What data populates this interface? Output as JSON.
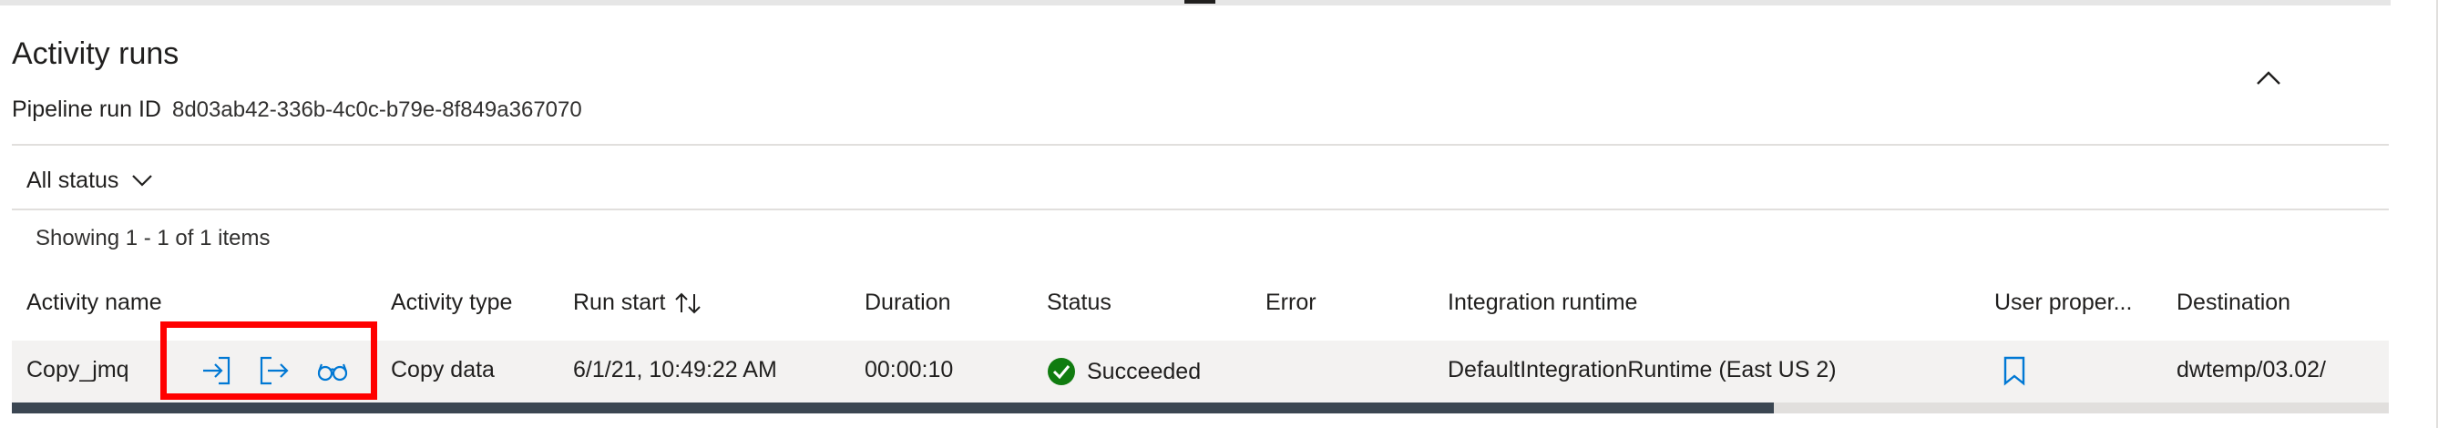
{
  "panel": {
    "title": "Activity runs",
    "run_id_label": "Pipeline run ID",
    "run_id_value": "8d03ab42-336b-4c0c-b79e-8f849a367070"
  },
  "filter": {
    "status_label": "All status"
  },
  "summary": {
    "showing": "Showing 1 - 1 of 1 items"
  },
  "table": {
    "columns": {
      "activity_name": "Activity name",
      "activity_type": "Activity type",
      "run_start": "Run start",
      "duration": "Duration",
      "status": "Status",
      "error": "Error",
      "integration_runtime": "Integration runtime",
      "user_properties": "User proper...",
      "destination": "Destination"
    },
    "rows": [
      {
        "activity_name": "Copy_jmq",
        "activity_type": "Copy data",
        "run_start": "6/1/21, 10:49:22 AM",
        "duration": "00:00:10",
        "status": "Succeeded",
        "error": "",
        "integration_runtime": "DefaultIntegrationRuntime (East US 2)",
        "destination": "dwtemp/03.02/"
      }
    ]
  },
  "icons": {
    "collapse": "chevron-up-icon",
    "filter_dropdown": "chevron-down-icon",
    "sort": "sort-arrows-icon",
    "input": "input-icon",
    "output": "output-icon",
    "details": "glasses-icon",
    "status_success": "checkmark-circle-icon",
    "user_properties": "bookmark-icon"
  },
  "colors": {
    "accent": "#0078d4",
    "success": "#107c10",
    "highlight": "#ff0000",
    "row_background": "#f3f2f1"
  },
  "scroll": {
    "horizontal_position": 0.74
  }
}
